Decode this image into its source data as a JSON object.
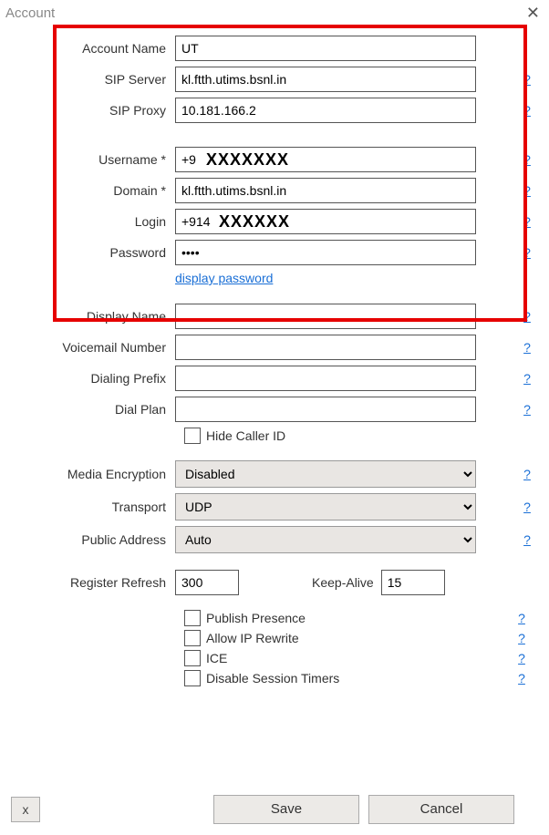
{
  "window": {
    "title": "Account"
  },
  "fields": {
    "account_name": {
      "label": "Account Name",
      "value": "UT"
    },
    "sip_server": {
      "label": "SIP Server",
      "value": "kl.ftth.utims.bsnl.in"
    },
    "sip_proxy": {
      "label": "SIP Proxy",
      "value": "10.181.166.2"
    },
    "username": {
      "label": "Username *",
      "value": "+9",
      "mask": "XXXXXXX"
    },
    "domain": {
      "label": "Domain *",
      "value": "kl.ftth.utims.bsnl.in"
    },
    "login": {
      "label": "Login",
      "value": "+914",
      "mask": "XXXXXX"
    },
    "password": {
      "label": "Password",
      "value": "••••"
    },
    "display_password_link": "display password",
    "display_name": {
      "label": "Display Name",
      "value": ""
    },
    "voicemail_number": {
      "label": "Voicemail Number",
      "value": ""
    },
    "dialing_prefix": {
      "label": "Dialing Prefix",
      "value": ""
    },
    "dial_plan": {
      "label": "Dial Plan",
      "value": ""
    },
    "hide_caller_id": {
      "label": "Hide Caller ID",
      "checked": false
    },
    "media_encryption": {
      "label": "Media Encryption",
      "value": "Disabled"
    },
    "transport": {
      "label": "Transport",
      "value": "UDP"
    },
    "public_address": {
      "label": "Public Address",
      "value": "Auto"
    },
    "register_refresh": {
      "label": "Register Refresh",
      "value": "300"
    },
    "keep_alive": {
      "label": "Keep-Alive",
      "value": "15"
    },
    "publish_presence": {
      "label": "Publish Presence",
      "checked": false
    },
    "allow_ip_rewrite": {
      "label": "Allow IP Rewrite",
      "checked": false
    },
    "ice": {
      "label": "ICE",
      "checked": false
    },
    "disable_session_timers": {
      "label": "Disable Session Timers",
      "checked": false
    }
  },
  "help_glyph": "?",
  "buttons": {
    "save": "Save",
    "cancel": "Cancel",
    "x": "x"
  }
}
